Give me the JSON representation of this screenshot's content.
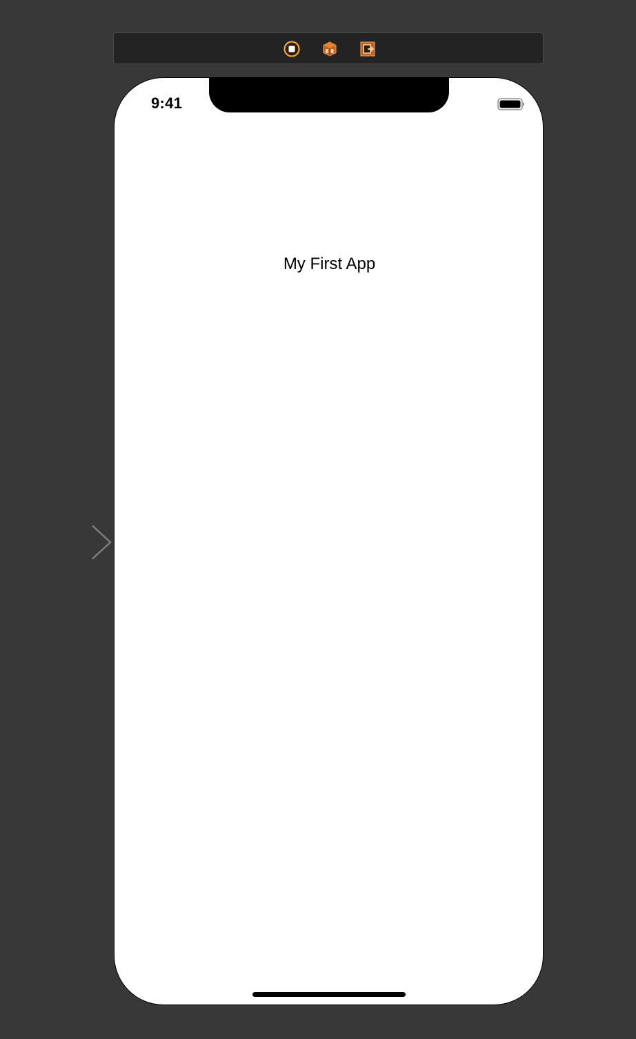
{
  "scene_dock": {
    "icons": [
      {
        "name": "view-controller-icon",
        "color": "#f5a623"
      },
      {
        "name": "first-responder-icon",
        "color": "#e8832a"
      },
      {
        "name": "exit-icon",
        "color": "#e8832a"
      }
    ]
  },
  "entry_point": {
    "icon": "arrow-right-icon"
  },
  "device": {
    "status_bar": {
      "time": "9:41",
      "battery_icon": "battery-icon"
    },
    "app_label": "My First App"
  },
  "colors": {
    "canvas_background": "#383838",
    "dock_background": "#232323",
    "screen_background": "#ffffff",
    "accent_orange": "#f5a623"
  }
}
